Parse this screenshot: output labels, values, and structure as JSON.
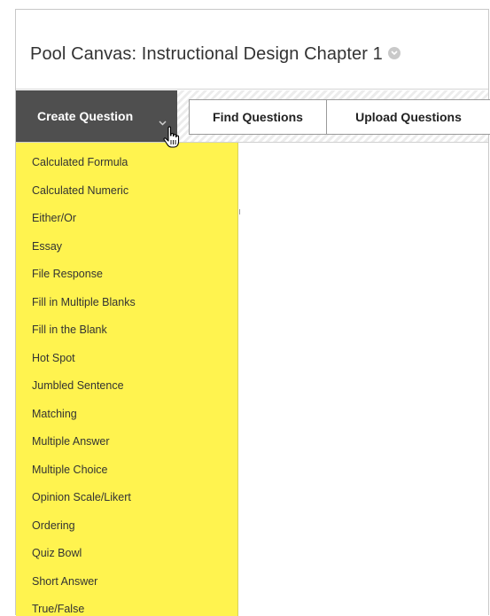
{
  "page": {
    "title": "Pool Canvas: Instructional Design Chapter 1"
  },
  "action_bar": {
    "create_question_label": "Create Question",
    "find_questions_label": "Find Questions",
    "upload_questions_label": "Upload Questions"
  },
  "dropdown": {
    "items": [
      {
        "label": "Calculated Formula"
      },
      {
        "label": "Calculated Numeric"
      },
      {
        "label": "Either/Or"
      },
      {
        "label": "Essay"
      },
      {
        "label": "File Response"
      },
      {
        "label": "Fill in Multiple Blanks"
      },
      {
        "label": "Fill in the Blank"
      },
      {
        "label": "Hot Spot"
      },
      {
        "label": "Jumbled Sentence"
      },
      {
        "label": "Matching"
      },
      {
        "label": "Multiple Answer"
      },
      {
        "label": "Multiple Choice"
      },
      {
        "label": "Opinion Scale/Likert"
      },
      {
        "label": "Ordering"
      },
      {
        "label": "Quiz Bowl"
      },
      {
        "label": "Short Answer"
      },
      {
        "label": "True/False"
      }
    ]
  },
  "colors": {
    "menu_highlight": "#fff34f",
    "create_button_bg": "#4f4f4f"
  },
  "icons": {
    "title_menu": "chevron-down-circle-icon",
    "create_caret": "chevron-down-icon",
    "pointer": "hand-pointer-icon"
  }
}
